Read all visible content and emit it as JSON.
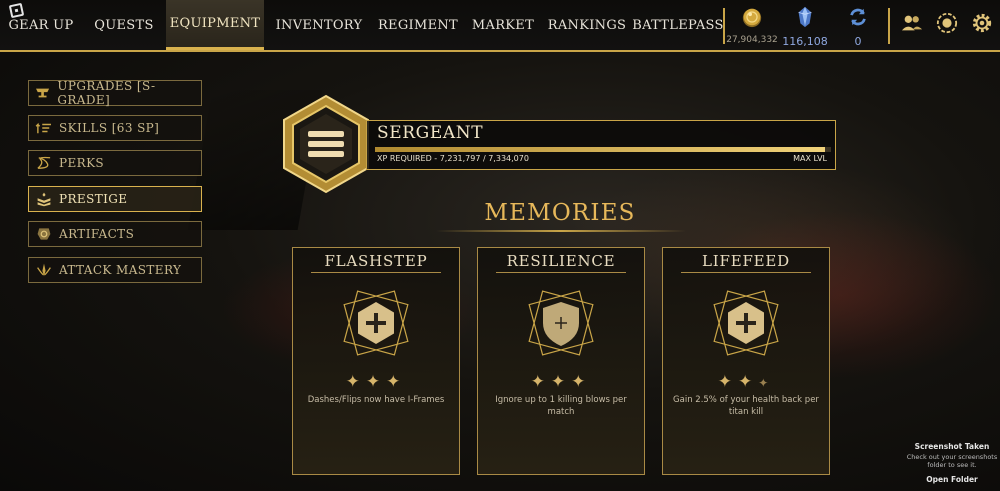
{
  "nav": {
    "items": [
      {
        "label": "GEAR UP"
      },
      {
        "label": "QUESTS"
      },
      {
        "label": "EQUIPMENT",
        "active": true
      },
      {
        "label": "INVENTORY"
      },
      {
        "label": "REGIMENT"
      },
      {
        "label": "MARKET"
      },
      {
        "label": "RANKINGS"
      },
      {
        "label": "BATTLEPASS"
      }
    ]
  },
  "currencies": [
    {
      "icon": "gold-coin-icon",
      "value": "27,904,332"
    },
    {
      "icon": "blue-crystal-icon",
      "value": "116,108"
    },
    {
      "icon": "refresh-token-icon",
      "value": "0"
    }
  ],
  "top_icons": [
    "friends-icon",
    "badge-icon",
    "settings-gear-icon"
  ],
  "sidebar": {
    "items": [
      {
        "label": "UPGRADES [S- GRADE]",
        "icon": "anvil-icon"
      },
      {
        "label": "SKILLS [63 SP]",
        "icon": "skills-icon"
      },
      {
        "label": "PERKS",
        "icon": "dna-icon"
      },
      {
        "label": "PRESTIGE",
        "icon": "chevron-rank-icon",
        "active": true
      },
      {
        "label": "ARTIFACTS",
        "icon": "artifact-icon"
      },
      {
        "label": "ATTACK MASTERY",
        "icon": "mastery-icon"
      }
    ]
  },
  "rank": {
    "name": "SERGEANT",
    "xp_label": "XP REQUIRED - 7,231,797 / 7,334,070",
    "xp_progress": 0.986,
    "max_label": "MAX LVL"
  },
  "memories": {
    "title": "MEMORIES",
    "cards": [
      {
        "title": "FLASHSTEP",
        "emblem": "hexagon-plus-icon",
        "stars": 3,
        "desc": "Dashes/Flips now have I-Frames"
      },
      {
        "title": "RESILIENCE",
        "emblem": "shield-plus-icon",
        "stars": 3,
        "desc": "Ignore up to 1 killing blows per match"
      },
      {
        "title": "LIFEFEED",
        "emblem": "hexagon-plus-icon",
        "stars": 2.5,
        "desc": "Gain 2.5% of your health back per titan kill"
      }
    ]
  },
  "toast": {
    "title": "Screenshot Taken",
    "message": "Check out your screenshots folder to see it.",
    "action": "Open Folder"
  },
  "colors": {
    "accent": "#c9a548",
    "text": "#e8dcc0",
    "blue_currency": "#8fa8e0"
  }
}
